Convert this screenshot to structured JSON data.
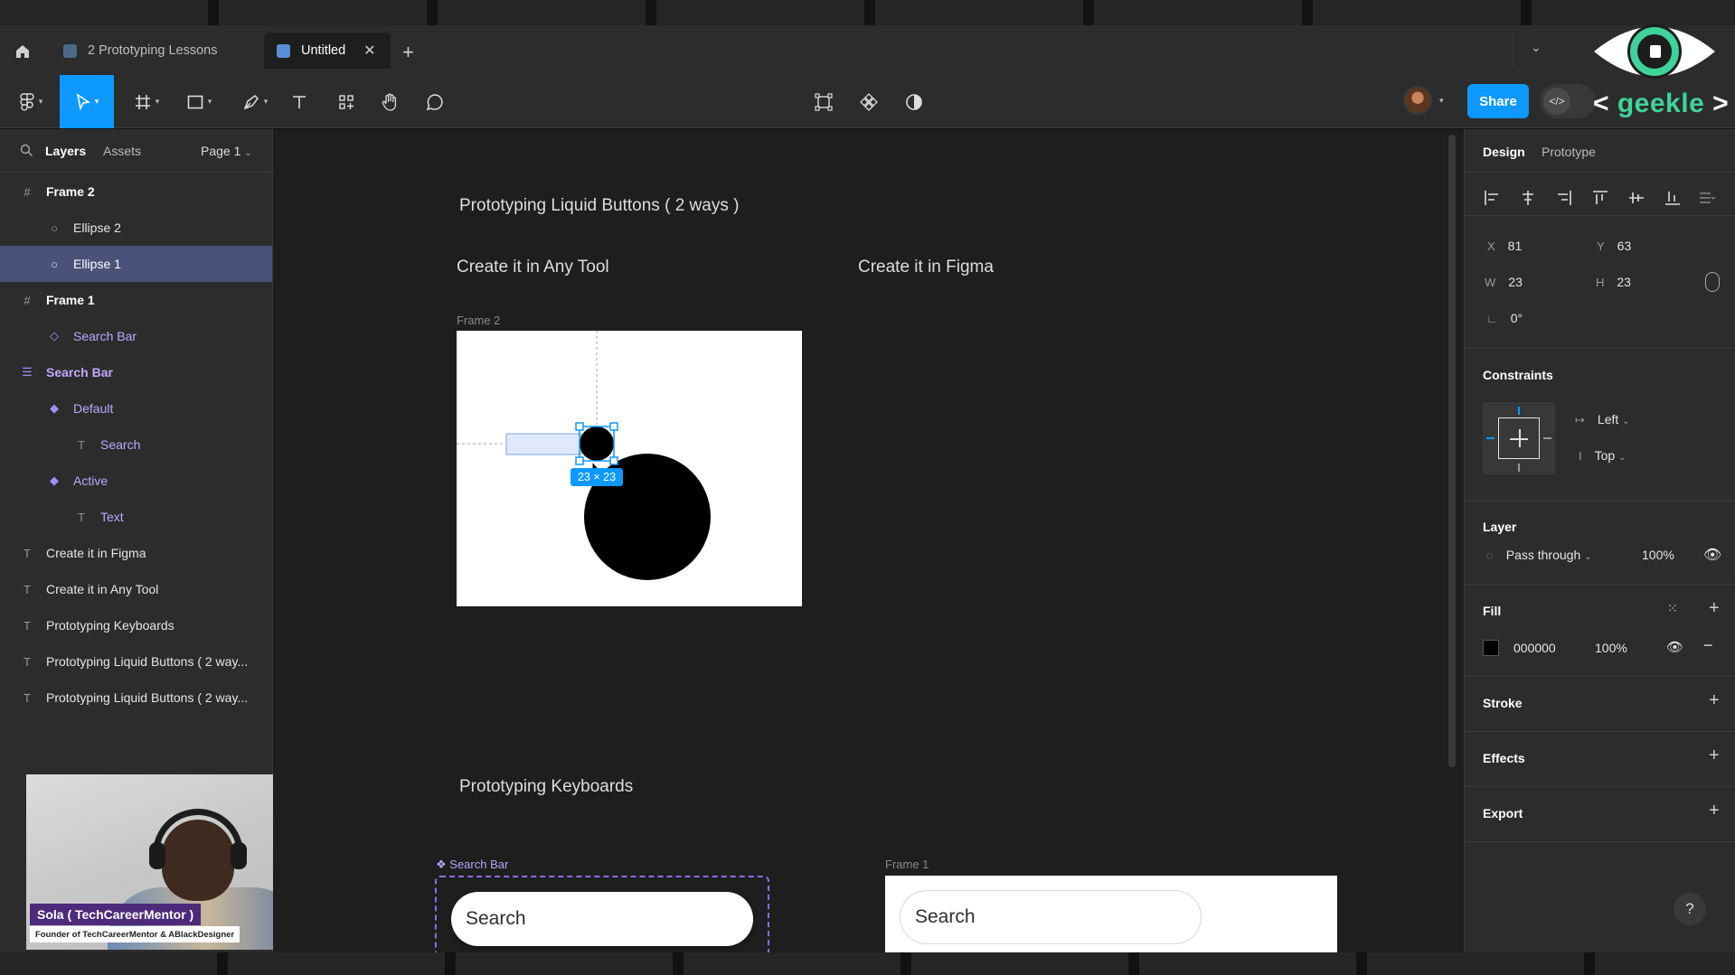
{
  "tabs": [
    {
      "label": "2 Prototyping Lessons",
      "active": false
    },
    {
      "label": "Untitled",
      "active": true
    }
  ],
  "share_label": "Share",
  "watermark": {
    "brand": "geekle"
  },
  "left_panel": {
    "tab_layers": "Layers",
    "tab_assets": "Assets",
    "page_label": "Page 1",
    "layers": [
      {
        "label": "Frame 2",
        "icon": "frame-icon",
        "type": "frame"
      },
      {
        "label": "Ellipse 2",
        "icon": "ellipse-icon",
        "type": "shape"
      },
      {
        "label": "Ellipse 1",
        "icon": "ellipse-icon",
        "type": "shape",
        "selected": true
      },
      {
        "label": "Frame 1",
        "icon": "frame-icon",
        "type": "frame"
      },
      {
        "label": "Search Bar",
        "icon": "instance-icon",
        "type": "instance"
      },
      {
        "label": "Search Bar",
        "icon": "component-set-icon",
        "type": "component-set"
      },
      {
        "label": "Default",
        "icon": "variant-icon",
        "type": "variant"
      },
      {
        "label": "Search",
        "icon": "text-icon",
        "type": "text"
      },
      {
        "label": "Active",
        "icon": "variant-icon",
        "type": "variant"
      },
      {
        "label": "Text",
        "icon": "text-icon",
        "type": "text"
      },
      {
        "label": "Create it in Figma",
        "icon": "text-icon",
        "type": "text"
      },
      {
        "label": "Create it in Any Tool",
        "icon": "text-icon",
        "type": "text"
      },
      {
        "label": "Prototyping Keyboards",
        "icon": "text-icon",
        "type": "text"
      },
      {
        "label": "Prototyping Liquid Buttons ( 2 way...",
        "icon": "text-icon",
        "type": "text"
      },
      {
        "label": "Prototyping Liquid Buttons ( 2 way...",
        "icon": "text-icon",
        "type": "text"
      }
    ]
  },
  "webcam": {
    "name": "Sola ( TechCareerMentor )",
    "title": "Founder of TechCareerMentor & ABlackDesigner"
  },
  "canvas": {
    "heading_liquid": "Prototyping Liquid Buttons ( 2 ways )",
    "heading_any_tool": "Create it in Any Tool",
    "heading_figma": "Create it in Figma",
    "frame2_label": "Frame 2",
    "size_badge": "23 × 23",
    "heading_keyboards": "Prototyping Keyboards",
    "component_label": "Search Bar",
    "frame1_label": "Frame 1",
    "search_placeholder_1": "Search",
    "search_placeholder_2": "Search"
  },
  "design_panel": {
    "tab_design": "Design",
    "tab_prototype": "Prototype",
    "x": "81",
    "y": "63",
    "w": "23",
    "h": "23",
    "rotation": "0°",
    "constraints_title": "Constraints",
    "constraint_h": "Left",
    "constraint_v": "Top",
    "layer_title": "Layer",
    "blend_mode": "Pass through",
    "layer_opacity": "100%",
    "fill_title": "Fill",
    "fill_hex": "000000",
    "fill_opacity": "100%",
    "fill_color": "#000000",
    "stroke_title": "Stroke",
    "effects_title": "Effects",
    "export_title": "Export"
  },
  "colors": {
    "accent": "#0d99ff",
    "selection_row": "#4a5279",
    "component_purple": "#8b6cf0"
  }
}
